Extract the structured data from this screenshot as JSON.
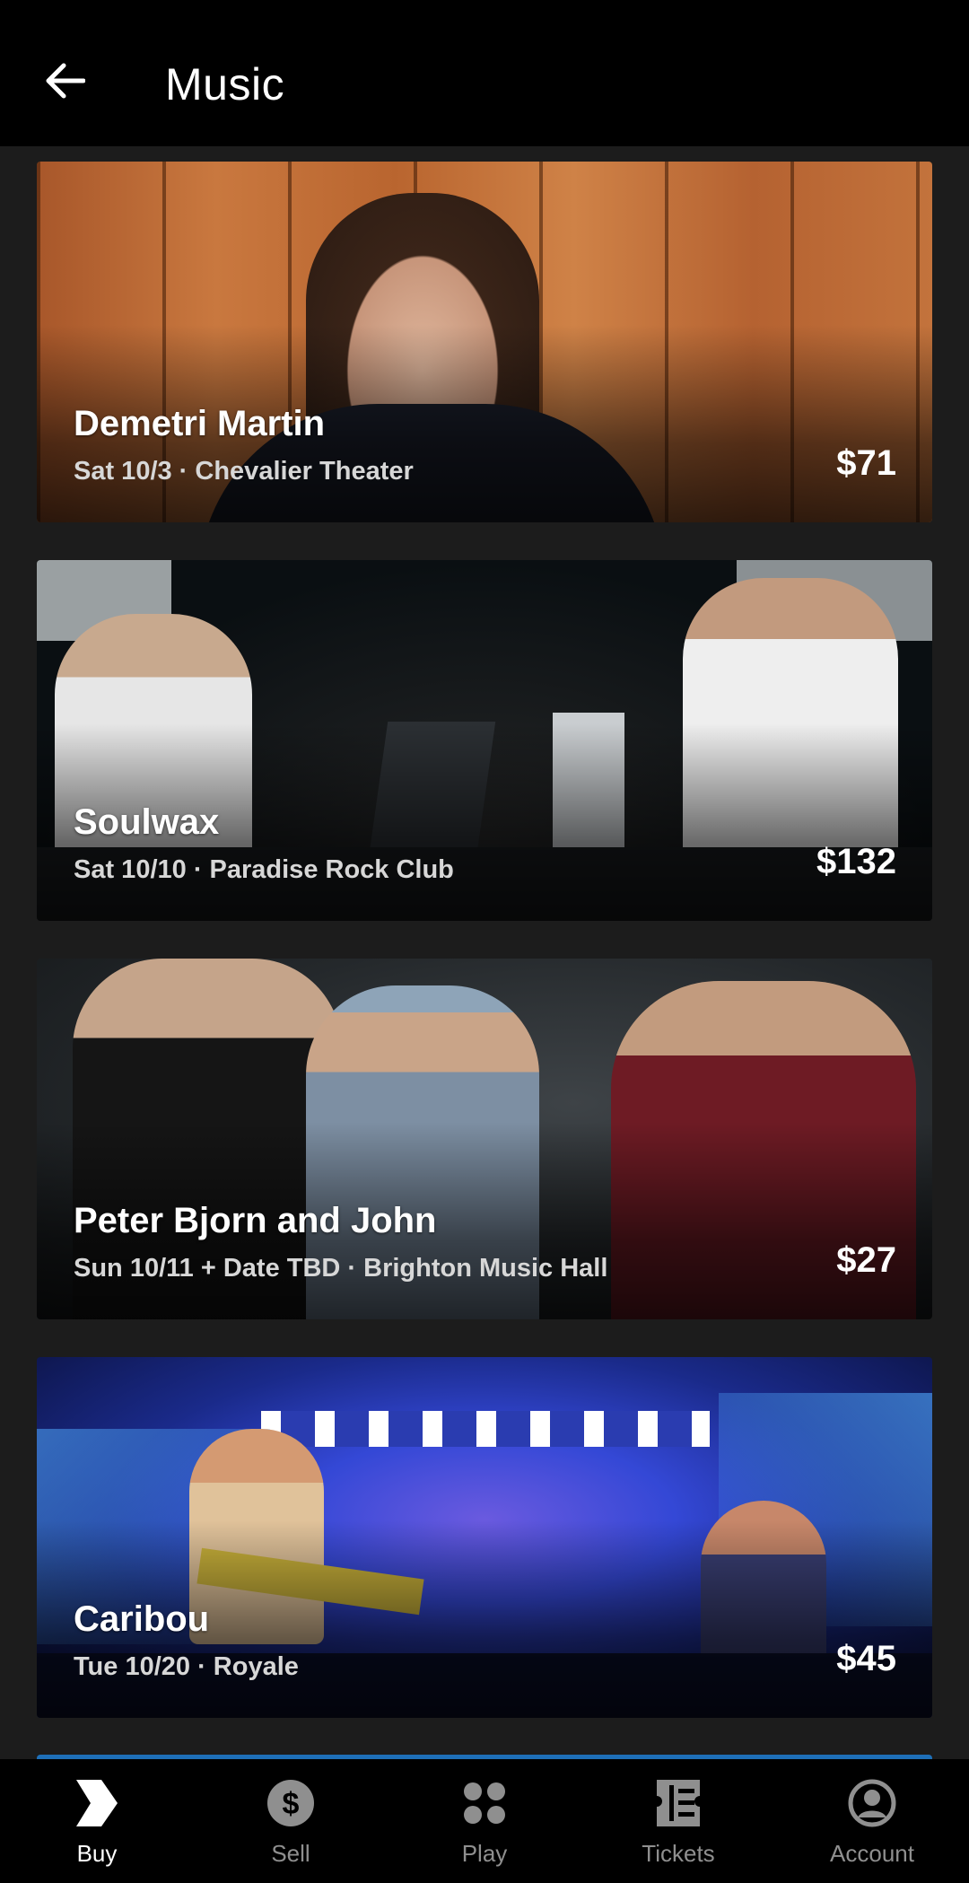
{
  "header": {
    "title": "Music"
  },
  "events": [
    {
      "name": "Demetri Martin",
      "meta": "Sat 10/3 · Chevalier Theater",
      "price": "$71"
    },
    {
      "name": "Soulwax",
      "meta": "Sat 10/10 · Paradise Rock Club",
      "price": "$132"
    },
    {
      "name": "Peter Bjorn and John",
      "meta": "Sun 10/11 + Date TBD  · Brighton Music Hall",
      "price": "$27"
    },
    {
      "name": "Caribou",
      "meta": "Tue 10/20 · Royale",
      "price": "$45"
    }
  ],
  "nav": {
    "items": [
      {
        "label": "Buy",
        "icon": "buy-icon",
        "active": true
      },
      {
        "label": "Sell",
        "icon": "dollar-icon",
        "active": false
      },
      {
        "label": "Play",
        "icon": "dots-icon",
        "active": false
      },
      {
        "label": "Tickets",
        "icon": "ticket-icon",
        "active": false
      },
      {
        "label": "Account",
        "icon": "account-icon",
        "active": false
      }
    ]
  },
  "colors": {
    "header_bg": "#000000",
    "list_bg": "#1c1c1c",
    "nav_inactive": "#8f8f8f",
    "nav_active": "#ffffff"
  }
}
